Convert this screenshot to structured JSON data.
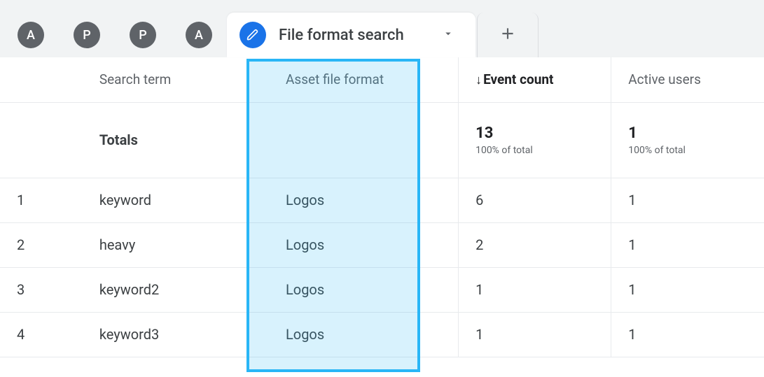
{
  "tabs": {
    "passive": [
      {
        "letter": "A"
      },
      {
        "letter": "P"
      },
      {
        "letter": "P"
      },
      {
        "letter": "A"
      }
    ],
    "active": {
      "label": "File format search"
    }
  },
  "columns": {
    "search_term": "Search term",
    "asset_format": "Asset file format",
    "event_count": "Event count",
    "active_users": "Active users"
  },
  "totals": {
    "label": "Totals",
    "event_count": "13",
    "event_pct": "100% of total",
    "active_users": "1",
    "users_pct": "100% of total"
  },
  "rows": [
    {
      "idx": "1",
      "term": "keyword",
      "format": "Logos",
      "events": "6",
      "users": "1"
    },
    {
      "idx": "2",
      "term": "heavy",
      "format": "Logos",
      "events": "2",
      "users": "1"
    },
    {
      "idx": "3",
      "term": "keyword2",
      "format": "Logos",
      "events": "1",
      "users": "1"
    },
    {
      "idx": "4",
      "term": "keyword3",
      "format": "Logos",
      "events": "1",
      "users": "1"
    }
  ]
}
